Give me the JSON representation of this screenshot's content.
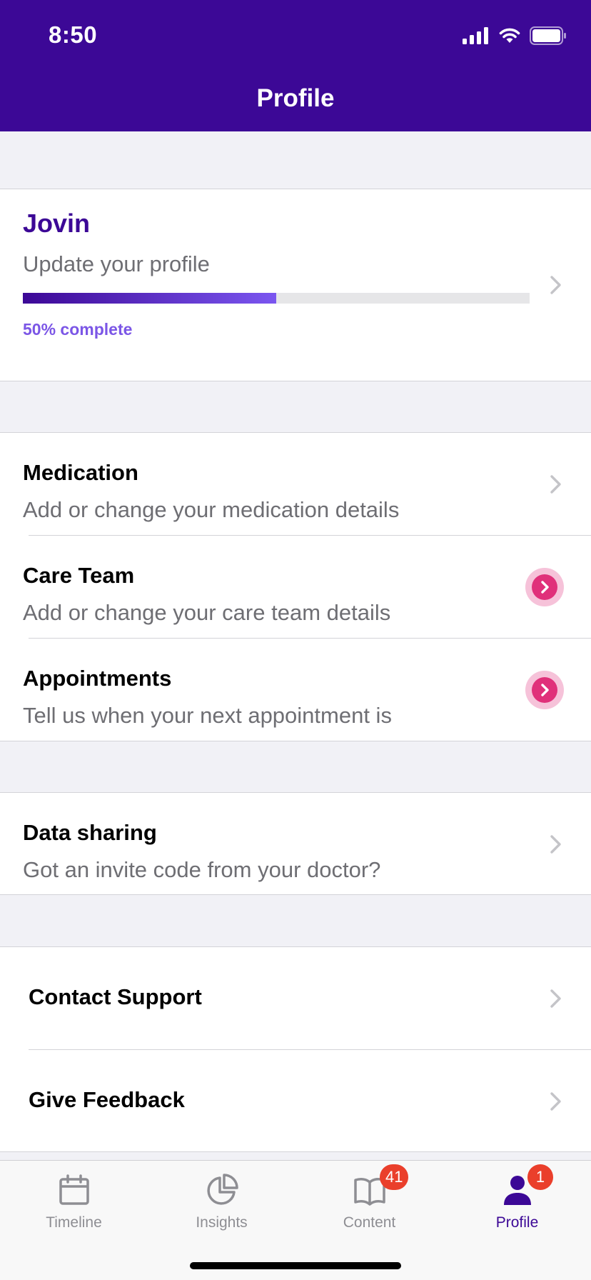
{
  "status_bar": {
    "time": "8:50"
  },
  "header": {
    "title": "Profile"
  },
  "profile": {
    "name": "Jovin",
    "subtitle": "Update your profile",
    "progress_fraction": 0.5,
    "progress_label": "50% complete"
  },
  "health_section": {
    "items": [
      {
        "title": "Medication",
        "subtitle": "Add or change your medication details",
        "action": "chevron"
      },
      {
        "title": "Care Team",
        "subtitle": "Add or change your care team details",
        "action": "highlighted"
      },
      {
        "title": "Appointments",
        "subtitle": "Tell us when your next appointment is",
        "action": "highlighted"
      }
    ]
  },
  "data_sharing": {
    "title": "Data sharing",
    "subtitle": "Got an invite code from your doctor?"
  },
  "support_section": {
    "items": [
      {
        "title": "Contact Support"
      },
      {
        "title": "Give Feedback"
      }
    ]
  },
  "tabbar": {
    "tabs": [
      {
        "label": "Timeline",
        "icon": "calendar-icon",
        "badge": ""
      },
      {
        "label": "Insights",
        "icon": "pie-chart-icon",
        "badge": ""
      },
      {
        "label": "Content",
        "icon": "book-icon",
        "badge": "41"
      },
      {
        "label": "Profile",
        "icon": "person-icon",
        "badge": "1",
        "active": true
      }
    ]
  },
  "colors": {
    "brand": "#3c0896",
    "progress_accent": "#7b56f0",
    "highlight_pink": "#e0307a",
    "badge_red": "#ea3f2b"
  }
}
